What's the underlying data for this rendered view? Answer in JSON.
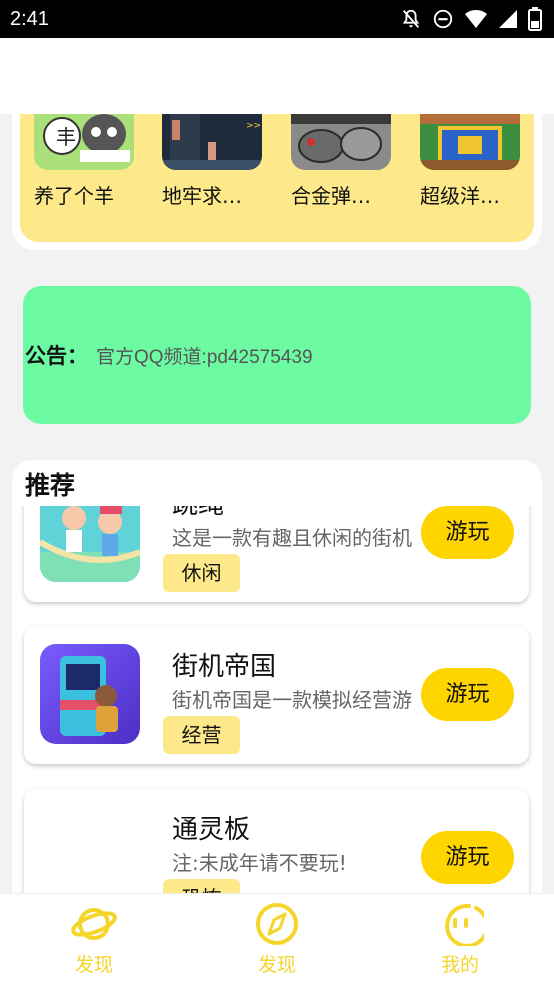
{
  "status_bar": {
    "time": "2:41",
    "icons": [
      "notifications-off-icon",
      "do-not-disturb-icon",
      "wifi-icon",
      "signal-icon",
      "battery-icon"
    ]
  },
  "games": [
    {
      "name": "养了个羊",
      "thumb": "sheep-game-thumb"
    },
    {
      "name": "地牢求…",
      "thumb": "dungeon-game-thumb"
    },
    {
      "name": "合金弹…",
      "thumb": "metal-slug-thumb"
    },
    {
      "name": "超级洋…",
      "thumb": "pixel-game-thumb"
    }
  ],
  "notice": {
    "label": "公告：",
    "text": "官方QQ频道:pd42575439"
  },
  "recommend": {
    "title": "推荐",
    "items": [
      {
        "name": "跳绳",
        "desc": "这是一款有趣且休闲的街机",
        "tag": "休闲",
        "button": "游玩"
      },
      {
        "name": "街机帝国",
        "desc": "街机帝国是一款模拟经营游",
        "tag": "经营",
        "button": "游玩"
      },
      {
        "name": "通灵板",
        "desc": "注:未成年请不要玩!",
        "tag": "恐怖",
        "button": "游玩"
      }
    ]
  },
  "bottom_nav": [
    {
      "label": "发现",
      "icon": "planet-icon"
    },
    {
      "label": "发现",
      "icon": "compass-icon"
    },
    {
      "label": "我的",
      "icon": "face-icon"
    }
  ],
  "colors": {
    "accent_yellow": "#ffd500",
    "strip_yellow": "#fde98a",
    "notice_green": "#6cfba3",
    "nav_yellow": "#f5d52a"
  }
}
